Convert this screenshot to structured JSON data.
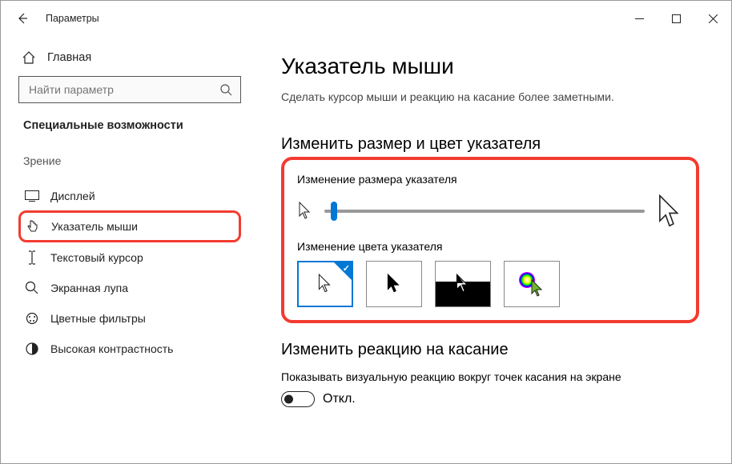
{
  "window": {
    "title": "Параметры"
  },
  "sidebar": {
    "home": "Главная",
    "search_placeholder": "Найти параметр",
    "category": "Специальные возможности",
    "group": "Зрение",
    "items": [
      {
        "label": "Дисплей"
      },
      {
        "label": "Указатель мыши",
        "selected": true
      },
      {
        "label": "Текстовый курсор"
      },
      {
        "label": "Экранная лупа"
      },
      {
        "label": "Цветные фильтры"
      },
      {
        "label": "Высокая контрастность"
      }
    ]
  },
  "main": {
    "title": "Указатель мыши",
    "subtitle": "Сделать курсор мыши и реакцию на касание более заметными.",
    "section1_title": "Изменить размер и цвет указателя",
    "size_label": "Изменение размера указателя",
    "color_label": "Изменение цвета указателя",
    "section2_title": "Изменить реакцию на касание",
    "touch_label": "Показывать визуальную реакцию вокруг точек касания на экране",
    "toggle_state": "Откл."
  }
}
